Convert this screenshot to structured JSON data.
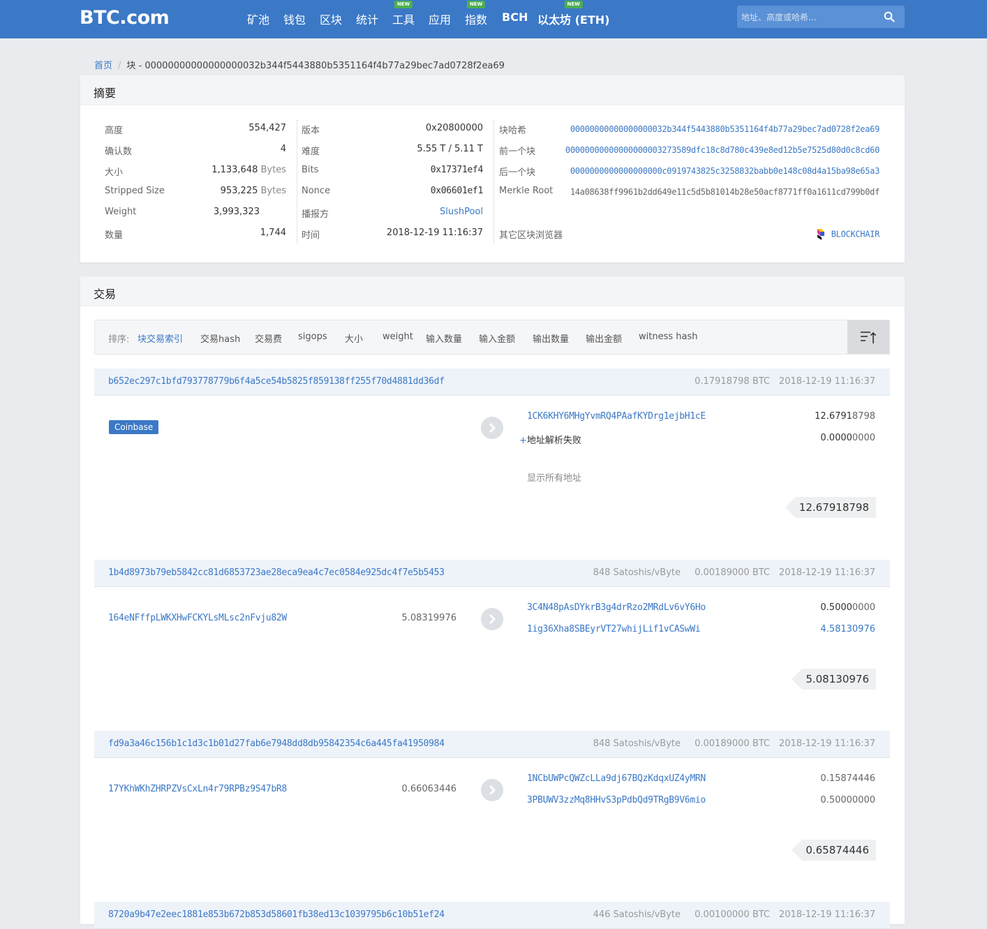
{
  "header": {
    "logo": "BTC.com",
    "nav": [
      {
        "label": "矿池",
        "new": false,
        "bold": false
      },
      {
        "label": "钱包",
        "new": false,
        "bold": false
      },
      {
        "label": "区块",
        "new": false,
        "bold": false
      },
      {
        "label": "统计",
        "new": false,
        "bold": false
      },
      {
        "label": "工具",
        "new": true,
        "bold": false
      },
      {
        "label": "应用",
        "new": false,
        "bold": false
      },
      {
        "label": "指数",
        "new": true,
        "bold": false
      },
      {
        "label": "BCH",
        "new": false,
        "bold": true
      },
      {
        "label": "以太坊 (ETH)",
        "new": true,
        "bold": true
      }
    ],
    "new_badge": "NEW",
    "search_placeholder": "地址、高度或哈希..."
  },
  "breadcrumb": {
    "home": "首页",
    "separator": "/",
    "current": "块 - 00000000000000000032b344f5443880b5351164f4b77a29bec7ad0728f2ea69"
  },
  "summary": {
    "title": "摘要",
    "col1": [
      {
        "label": "高度",
        "value": "554,427",
        "unit": ""
      },
      {
        "label": "确认数",
        "value": "4",
        "unit": ""
      },
      {
        "label": "大小",
        "value": "1,133,648",
        "unit": "Bytes"
      },
      {
        "label": "Stripped Size",
        "value": "953,225",
        "unit": "Bytes"
      },
      {
        "label": "Weight",
        "value": "3,993,323",
        "unit": ""
      },
      {
        "label": "数量",
        "value": "1,744",
        "unit": ""
      }
    ],
    "col2": [
      {
        "label": "版本",
        "value": "0x20800000"
      },
      {
        "label": "难度",
        "value": "5.55 T / 5.11 T"
      },
      {
        "label": "Bits",
        "value": "0x17371ef4"
      },
      {
        "label": "Nonce",
        "value": "0x06601ef1"
      },
      {
        "label": "播报方",
        "value": "SlushPool"
      },
      {
        "label": "时间",
        "value": "2018-12-19 11:16:37"
      }
    ],
    "col3": [
      {
        "label": "块哈希",
        "value": "00000000000000000032b344f5443880b5351164f4b77a29bec7ad0728f2ea69"
      },
      {
        "label": "前一个块",
        "value": "00000000000000000003273589dfc18c8d780c439e8ed12b5e7525d80d0c8cd60"
      },
      {
        "label": "后一个块",
        "value": "0000000000000000000c0919743825c3258832babb0e148c08d4a15ba98e65a3"
      },
      {
        "label": "Merkle Root",
        "value": "14a08638ff9961b2dd649e11c5d5b81014b28e50acf8771ff0a1611cd799b0df"
      }
    ],
    "other_explorers_label": "其它区块浏览器",
    "other_explorer": "BLOCKCHAIR"
  },
  "transactions": {
    "title": "交易",
    "sort_label": "排序:",
    "sort_options": [
      "块交易索引",
      "交易hash",
      "交易费",
      "sigops",
      "大小",
      "weight",
      "输入数量",
      "输入金额",
      "输出数量",
      "输出金额",
      "witness hash"
    ],
    "list": [
      {
        "hash": "b652ec297c1bfd793778779b6f4a5ce54b5825f859138ff255f70d4881dd36df",
        "fee_rate": "",
        "fee": "0.17918798 BTC",
        "time": "2018-12-19 11:16:37",
        "coinbase_label": "Coinbase",
        "input_addr": "",
        "input_amount": "",
        "outputs": [
          {
            "addr": "1CK6KHY6MHgYvmRQ4PAafKYDrg1ejbH1cE",
            "amount_hi": "12.6791",
            "amount_lo": "8798"
          },
          {
            "addr": "地址解析失败",
            "amount_hi": "0.0000",
            "amount_lo": "0000"
          }
        ],
        "show_all": "显示所有地址",
        "total": "12.67918798"
      },
      {
        "hash": "1b4d8973b79eb5842cc81d6853723ae28eca9ea4c7ec0584e925dc4f7e5b5453",
        "fee_rate": "848 Satoshis/vByte",
        "fee": "0.00189000 BTC",
        "time": "2018-12-19 11:16:37",
        "coinbase_label": "",
        "input_addr": "164eNFffpLWKXHwFCKYLsMLsc2nFvju82W",
        "input_amount": "5.08319976",
        "outputs": [
          {
            "addr": "3C4N48pAsDYkrB3g4drRzo2MRdLv6vY6Ho",
            "amount_hi": "0.5000",
            "amount_lo": "0000"
          },
          {
            "addr": "1ig36Xha8SBEyrVT27whijLif1vCASwWi",
            "amount_hi": "",
            "amount_lo": "4.58130976"
          }
        ],
        "show_all": "",
        "total": "5.08130976"
      },
      {
        "hash": "fd9a3a46c156b1c1d3c1b01d27fab6e7948dd8db95842354c6a445fa41950984",
        "fee_rate": "848 Satoshis/vByte",
        "fee": "0.00189000 BTC",
        "time": "2018-12-19 11:16:37",
        "coinbase_label": "",
        "input_addr": "17YKhWKhZHRPZVsCxLn4r79RPBz9S47bR8",
        "input_amount": "0.66063446",
        "outputs": [
          {
            "addr": "1NCbUWPcQWZcLLa9dj67BQzKdqxUZ4yMRN",
            "amount_hi": "",
            "amount_lo": "0.15874446"
          },
          {
            "addr": "3PBUWV3zzMq8HHvS3pPdbQd9TRgB9V6mio",
            "amount_hi": "",
            "amount_lo": "0.50000000"
          }
        ],
        "show_all": "",
        "total": "0.65874446"
      },
      {
        "hash": "8720a9b47e2eec1881e853b672b853d58601fb38ed13c1039795b6c10b51ef24",
        "fee_rate": "446 Satoshis/vByte",
        "fee": "0.00100000 BTC",
        "time": "2018-12-19 11:16:37"
      }
    ]
  }
}
